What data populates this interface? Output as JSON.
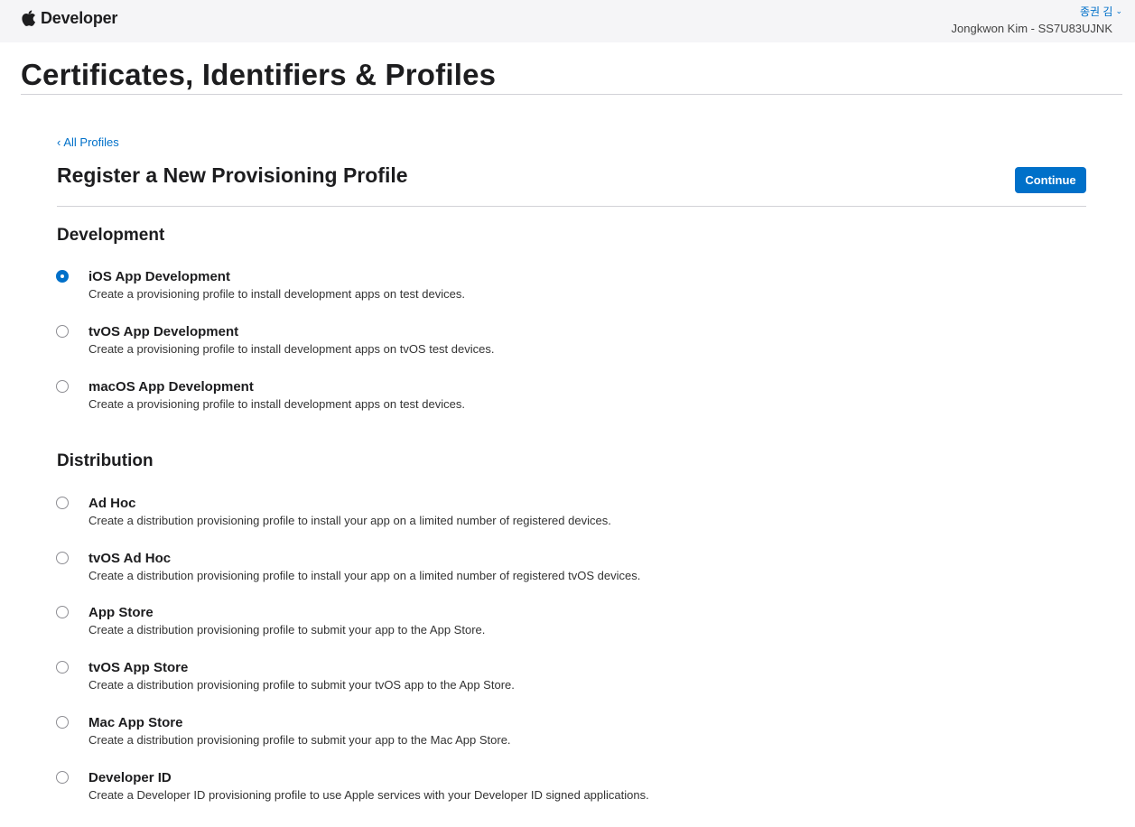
{
  "header": {
    "brand": "Developer",
    "user_name": "종권 김",
    "team": "Jongkwon Kim - SS7U83UJNK"
  },
  "page_title": "Certificates, Identifiers & Profiles",
  "breadcrumb": {
    "back_label": "All Profiles"
  },
  "form": {
    "title": "Register a New Provisioning Profile",
    "continue_label": "Continue"
  },
  "sections": {
    "development": {
      "heading": "Development",
      "options": [
        {
          "title": "iOS App Development",
          "description": "Create a provisioning profile to install development apps on test devices.",
          "selected": true
        },
        {
          "title": "tvOS App Development",
          "description": "Create a provisioning profile to install development apps on tvOS test devices.",
          "selected": false
        },
        {
          "title": "macOS App Development",
          "description": "Create a provisioning profile to install development apps on test devices.",
          "selected": false
        }
      ]
    },
    "distribution": {
      "heading": "Distribution",
      "options": [
        {
          "title": "Ad Hoc",
          "description": "Create a distribution provisioning profile to install your app on a limited number of registered devices.",
          "selected": false
        },
        {
          "title": "tvOS Ad Hoc",
          "description": "Create a distribution provisioning profile to install your app on a limited number of registered tvOS devices.",
          "selected": false
        },
        {
          "title": "App Store",
          "description": "Create a distribution provisioning profile to submit your app to the App Store.",
          "selected": false
        },
        {
          "title": "tvOS App Store",
          "description": "Create a distribution provisioning profile to submit your tvOS app to the App Store.",
          "selected": false
        },
        {
          "title": "Mac App Store",
          "description": "Create a distribution provisioning profile to submit your app to the Mac App Store.",
          "selected": false
        },
        {
          "title": "Developer ID",
          "description": "Create a Developer ID provisioning profile to use Apple services with your Developer ID signed applications.",
          "selected": false
        }
      ]
    }
  },
  "icons": {
    "brand": "apple-logo-icon",
    "user_menu": "chevron-down-icon",
    "back": "chevron-left-icon"
  },
  "colors": {
    "accent": "#0070c9",
    "topbar": "#f5f5f7",
    "text": "#1d1d1f"
  }
}
